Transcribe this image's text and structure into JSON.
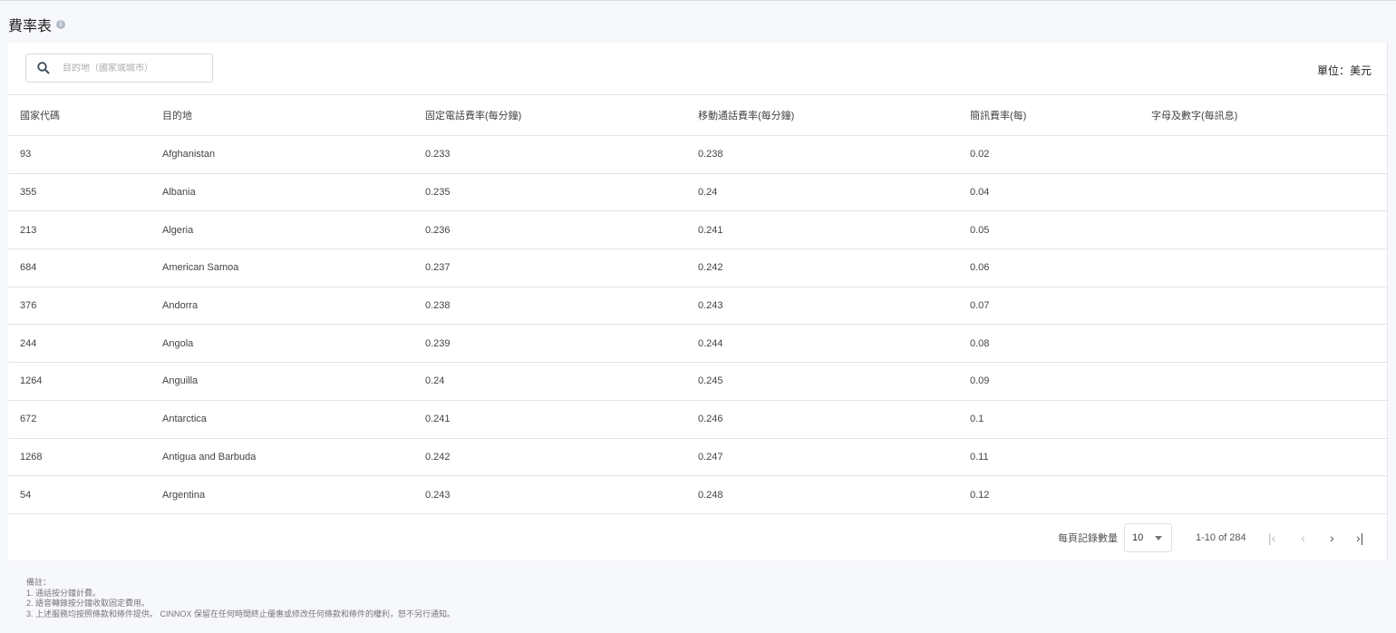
{
  "title": "費率表",
  "search": {
    "placeholder": "目的地（國家或城市）"
  },
  "unit": "單位：美元",
  "columns": [
    "國家代碼",
    "目的地",
    "固定電話費率(每分鐘)",
    "移動通話費率(每分鐘)",
    "簡訊費率(每)",
    "字母及數字(每訊息)"
  ],
  "rows": [
    [
      "93",
      "Afghanistan",
      "0.233",
      "0.238",
      "0.02",
      ""
    ],
    [
      "355",
      "Albania",
      "0.235",
      "0.24",
      "0.04",
      ""
    ],
    [
      "213",
      "Algeria",
      "0.236",
      "0.241",
      "0.05",
      ""
    ],
    [
      "684",
      "American Samoa",
      "0.237",
      "0.242",
      "0.06",
      ""
    ],
    [
      "376",
      "Andorra",
      "0.238",
      "0.243",
      "0.07",
      ""
    ],
    [
      "244",
      "Angola",
      "0.239",
      "0.244",
      "0.08",
      ""
    ],
    [
      "1264",
      "Anguilla",
      "0.24",
      "0.245",
      "0.09",
      ""
    ],
    [
      "672",
      "Antarctica",
      "0.241",
      "0.246",
      "0.1",
      ""
    ],
    [
      "1268",
      "Antigua and Barbuda",
      "0.242",
      "0.247",
      "0.11",
      ""
    ],
    [
      "54",
      "Argentina",
      "0.243",
      "0.248",
      "0.12",
      ""
    ]
  ],
  "pagination": {
    "per_page_label": "每頁記錄數量",
    "per_page": "10",
    "range": "1-10 of 284"
  },
  "notes": [
    "備註：",
    "1. 通話按分鐘計費。",
    "2. 語音轉錄按分鐘收取固定費用。",
    "3. 上述服務均按照條款和條件提供。 CINNOX 保留在任何時間終止優惠或修改任何條款和條件的權利，恕不另行通知。"
  ]
}
